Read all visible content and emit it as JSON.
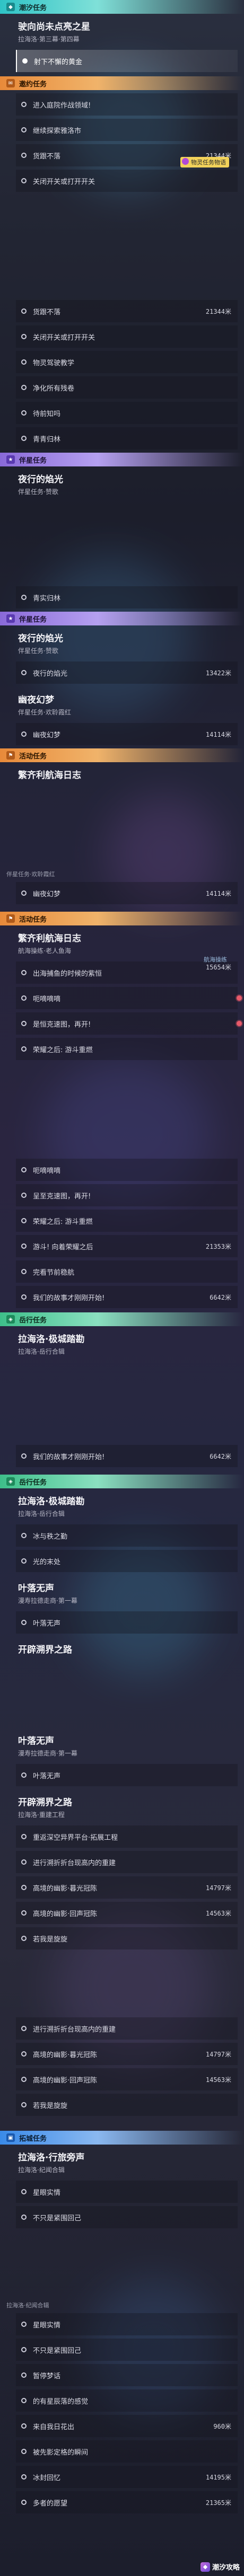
{
  "p1": {
    "sec1": {
      "label": "潮汐任务",
      "icon": "tide-icon"
    },
    "q1": {
      "title": "驶向尚未点亮之星",
      "sub": "拉海洛·第三幕·第四幕"
    },
    "o1": "射下不懈的黄金",
    "sec2": {
      "label": "邀约任务",
      "icon": "invite-icon"
    },
    "o2": "进入庭院作战领域!",
    "o3": "继续探索雅洛市",
    "popup": "物灵任务物语",
    "o4": {
      "text": "货跟不落",
      "dist": "21344米"
    },
    "o5": "关闭开关或打开开关"
  },
  "p2": {
    "o1": {
      "text": "货跟不落",
      "dist": "21344米"
    },
    "o2": "关闭开关或打开开关",
    "o3": "物灵驾驶教学",
    "o4": "净化所有残卷",
    "o5": "待前知吗",
    "o6": "青青归林",
    "sec": {
      "label": "伴星任务",
      "icon": "star-icon"
    },
    "q": {
      "title": "夜行的焰光",
      "sub": "伴星任务·赞歌"
    }
  },
  "p3": {
    "o1": "青实归林",
    "sec": {
      "label": "伴星任务",
      "icon": "star-icon"
    },
    "q1": {
      "title": "夜行的焰光",
      "sub": "伴星任务·赞歌"
    },
    "o2": {
      "text": "夜行的焰光",
      "dist": "13422米"
    },
    "q2": {
      "title": "幽夜幻梦",
      "sub": "伴星任务·欢聆霞红"
    },
    "o3": {
      "text": "幽夜幻梦",
      "dist": "14114米"
    },
    "sec2": {
      "label": "活动任务",
      "icon": "event-icon"
    },
    "q3": {
      "title": "繁齐利航海日志",
      "sub": ""
    }
  },
  "p4": {
    "top": "伴星任务·欢聆霞红",
    "o1": {
      "text": "幽夜幻梦",
      "dist": "14114米"
    },
    "sec": {
      "label": "活动任务",
      "icon": "event-icon"
    },
    "q": {
      "title": "繁齐利航海日志",
      "sub": "航海操练·老人鱼海"
    },
    "o2": {
      "text": "出海捕鱼的时候的紫恒",
      "dist": "15654米"
    },
    "nav": "航海操练",
    "o3": "呃嘀嘀嘀",
    "o4": "是恒克速图，再开!",
    "o5": "荣耀之后: 游斗重燃"
  },
  "p5": {
    "o1": "呃嘀嘀嘀",
    "o2": "呈至克速图，再开!",
    "o3": "荣耀之后: 游斗重燃",
    "o4": {
      "text": "游斗! 向着荣耀之后",
      "dist": "21353米"
    },
    "o5": "完看节前稳航",
    "o6": {
      "text": "我们的故事才刚刚开始!",
      "dist": "6642米"
    },
    "sec": {
      "label": "岳行任务",
      "icon": "side-icon"
    },
    "q": {
      "title": "拉海洛·极城踏勘",
      "sub": "拉海洛·岳行合辑"
    }
  },
  "p6": {
    "o1": {
      "text": "我们的故事才刚刚开始!",
      "dist": "6642米"
    },
    "sec": {
      "label": "岳行任务",
      "icon": "side-icon"
    },
    "q1": {
      "title": "拉海洛·极城踏勘",
      "sub": "拉海洛·岳行合辑"
    },
    "o2": "冰与秩之勤",
    "o3": "光的末处",
    "q2": {
      "title": "叶落无声",
      "sub": "漫寿拉德走商·第一幕"
    },
    "o4": "叶落无声",
    "q3": {
      "title": "开辟溯界之路",
      "sub": ""
    }
  },
  "p7": {
    "q1": {
      "title": "叶落无声",
      "sub": "漫寿拉德走商·第一幕"
    },
    "o1": "叶落无声",
    "q2": {
      "title": "开辟溯界之路",
      "sub": "拉海洛·重建工程"
    },
    "o2": "重返深空异界平台·拓展工程",
    "o3": "进行溯折折台现高内的重建",
    "o4": {
      "text": "高境的幽影·暮光冠陈",
      "dist": "14797米"
    },
    "o5": {
      "text": "高境的幽影·回声冠陈",
      "dist": "14563米"
    },
    "o6": "若我是旋旋"
  },
  "p8": {
    "o1": "进行溯折折台现高内的重建",
    "o2": {
      "text": "高境的幽影·暮光冠陈",
      "dist": "14797米"
    },
    "o3": {
      "text": "高境的幽影·回声冠陈",
      "dist": "14563米"
    },
    "o4": "若我是旋旋",
    "sec": {
      "label": "拓城任务",
      "icon": "city-icon"
    },
    "q": {
      "title": "拉海洛·行旅旁声",
      "sub": "拉海洛·纪闻合辑"
    },
    "o5": "星眼实情",
    "o6": "不只是紧围回己"
  },
  "p9": {
    "top": "拉海洛·纪闻合辑",
    "o1": "星眼实情",
    "o2": "不只是紧围回己",
    "o3": "暂停梦话",
    "o4": "的有星辰落的感觉",
    "o5": {
      "text": "来自我日花出",
      "dist": "960米"
    },
    "o6": "被先影定格的瞬间",
    "o7": {
      "text": "冰封回忆",
      "dist": "14195米"
    },
    "o8": {
      "text": "多者的愿望",
      "dist": "21365米"
    },
    "watermark": "潮汐攻略"
  },
  "colors": {
    "cyan": "#2fc3c6",
    "orange": "#e88a3a",
    "purple": "#8a6ad8",
    "green": "#3ebf8a",
    "blue": "#3a8ae8",
    "marker": "#e85a6a"
  }
}
